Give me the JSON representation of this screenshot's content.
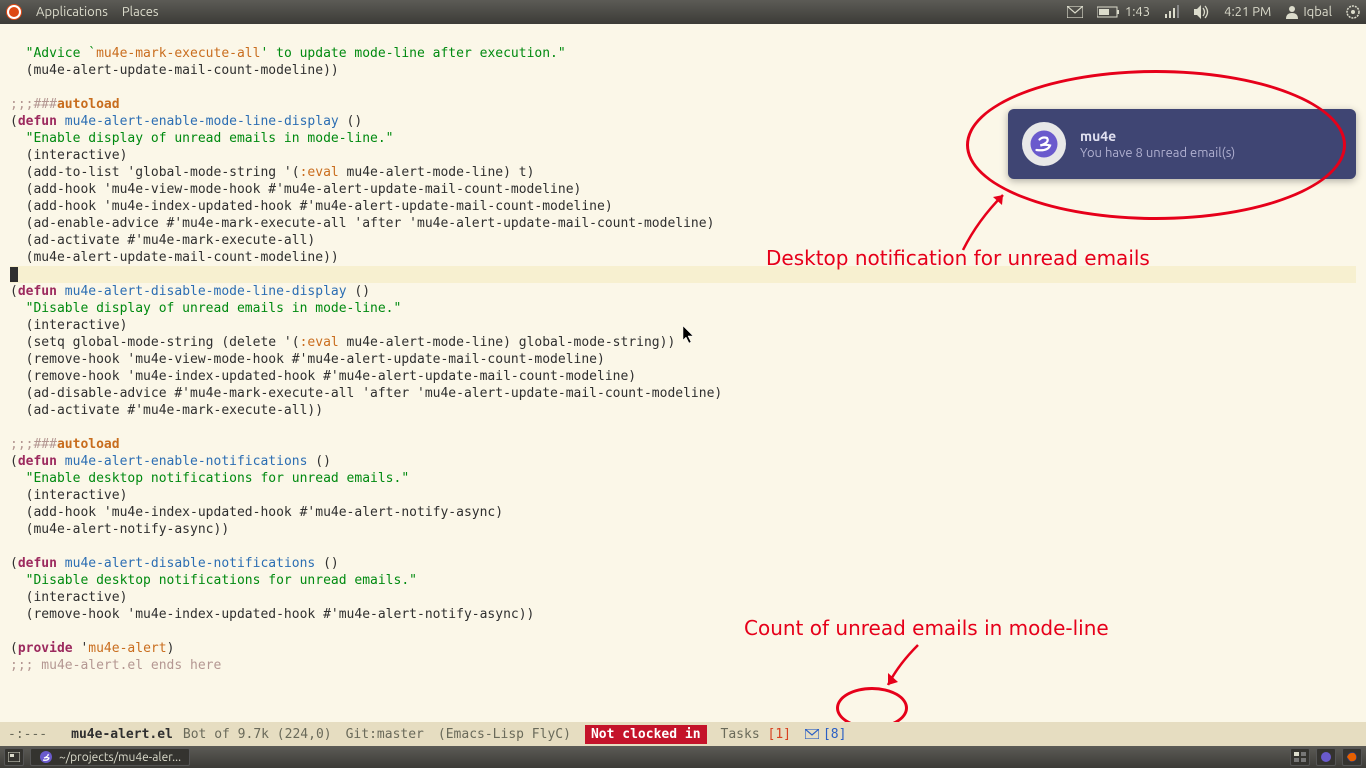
{
  "top_panel": {
    "applications": "Applications",
    "places": "Places",
    "battery_time": "1:43",
    "clock": "4:21 PM",
    "user": "Iqbal"
  },
  "notification": {
    "title": "mu4e",
    "body": "You have 8 unread email(s)"
  },
  "annotations": {
    "notif": "Desktop notification for unread emails",
    "modeline": "Count of unread emails in mode-line"
  },
  "modeline": {
    "state": "-:---",
    "buffer": "mu4e-alert.el",
    "pos": "Bot of 9.7k (224,0)",
    "vc": "Git:master",
    "modes": "(Emacs-Lisp FlyC)",
    "clock": "Not clocked in",
    "tasks_label": "Tasks",
    "tasks_count": "[1]",
    "mail_count": "[8]"
  },
  "bottom_panel": {
    "task1": "~/projects/mu4e-aler..."
  },
  "code": {
    "l01a": "  \"Advice `",
    "l01b": "mu4e-mark-execute-all",
    "l01c": "' to update mode-line after execution.\"",
    "l02": "  (mu4e-alert-update-mail-count-modeline))",
    "l03": "",
    "l04a": ";;;###",
    "l04b": "autoload",
    "l05a": "(",
    "l05b": "defun",
    "l05c": " ",
    "l05d": "mu4e-alert-enable-mode-line-display",
    "l05e": " ()",
    "l06": "  \"Enable display of unread emails in mode-line.\"",
    "l07": "  (interactive)",
    "l08a": "  (add-to-list 'global-mode-string '(",
    "l08b": ":eval",
    "l08c": " mu4e-alert-mode-line) t)",
    "l09": "  (add-hook 'mu4e-view-mode-hook #'mu4e-alert-update-mail-count-modeline)",
    "l10": "  (add-hook 'mu4e-index-updated-hook #'mu4e-alert-update-mail-count-modeline)",
    "l11": "  (ad-enable-advice #'mu4e-mark-execute-all 'after 'mu4e-alert-update-mail-count-modeline)",
    "l12": "  (ad-activate #'mu4e-mark-execute-all)",
    "l13": "  (mu4e-alert-update-mail-count-modeline))",
    "l14": "",
    "l15a": "(",
    "l15b": "defun",
    "l15c": " ",
    "l15d": "mu4e-alert-disable-mode-line-display",
    "l15e": " ()",
    "l16": "  \"Disable display of unread emails in mode-line.\"",
    "l17": "  (interactive)",
    "l18a": "  (setq global-mode-string (delete '(",
    "l18b": ":eval",
    "l18c": " mu4e-alert-mode-line) global-mode-string))",
    "l19": "  (remove-hook 'mu4e-view-mode-hook #'mu4e-alert-update-mail-count-modeline)",
    "l20": "  (remove-hook 'mu4e-index-updated-hook #'mu4e-alert-update-mail-count-modeline)",
    "l21": "  (ad-disable-advice #'mu4e-mark-execute-all 'after 'mu4e-alert-update-mail-count-modeline)",
    "l22": "  (ad-activate #'mu4e-mark-execute-all))",
    "l23": "",
    "l24a": ";;;###",
    "l24b": "autoload",
    "l25a": "(",
    "l25b": "defun",
    "l25c": " ",
    "l25d": "mu4e-alert-enable-notifications",
    "l25e": " ()",
    "l26": "  \"Enable desktop notifications for unread emails.\"",
    "l27": "  (interactive)",
    "l28": "  (add-hook 'mu4e-index-updated-hook #'mu4e-alert-notify-async)",
    "l29": "  (mu4e-alert-notify-async))",
    "l30": "",
    "l31a": "(",
    "l31b": "defun",
    "l31c": " ",
    "l31d": "mu4e-alert-disable-notifications",
    "l31e": " ()",
    "l32": "  \"Disable desktop notifications for unread emails.\"",
    "l33": "  (interactive)",
    "l34": "  (remove-hook 'mu4e-index-updated-hook #'mu4e-alert-notify-async))",
    "l35": "",
    "l36a": "(",
    "l36b": "provide",
    "l36c": " '",
    "l36d": "mu4e-alert",
    "l36e": ")",
    "l37": ";;; mu4e-alert.el ends here"
  }
}
